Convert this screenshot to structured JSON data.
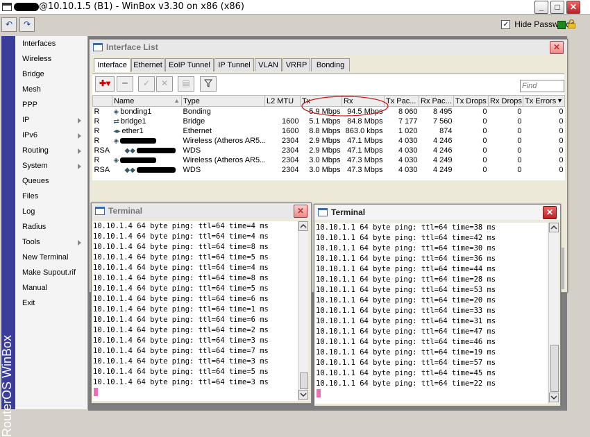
{
  "window": {
    "title_prefix": "",
    "title": "@10.10.1.5 (B1) - WinBox v3.30 on x86 (x86)",
    "min_glyph": "_",
    "max_glyph": "□",
    "close_glyph": "✕"
  },
  "toolbar": {
    "undo_glyph": "↶",
    "redo_glyph": "↷",
    "hide_passwords_label": "Hide Passwords",
    "hide_passwords_checked": "✓"
  },
  "sidebar": {
    "brand": "RouterOS WinBox",
    "items": [
      {
        "label": "Interfaces"
      },
      {
        "label": "Wireless"
      },
      {
        "label": "Bridge"
      },
      {
        "label": "Mesh"
      },
      {
        "label": "PPP"
      },
      {
        "label": "IP"
      },
      {
        "label": "IPv6"
      },
      {
        "label": "Routing"
      },
      {
        "label": "System"
      },
      {
        "label": "Queues"
      },
      {
        "label": "Files"
      },
      {
        "label": "Log"
      },
      {
        "label": "Radius"
      },
      {
        "label": "Tools"
      },
      {
        "label": "New Terminal"
      },
      {
        "label": "Make Supout.rif"
      },
      {
        "label": "Manual"
      },
      {
        "label": "Exit"
      }
    ]
  },
  "interface_list": {
    "title": "Interface List",
    "tabs": [
      "Interface",
      "Ethernet",
      "EoIP Tunnel",
      "IP Tunnel",
      "VLAN",
      "VRRP",
      "Bonding"
    ],
    "find_placeholder": "Find",
    "columns": [
      "",
      "Name",
      "Type",
      "L2 MTU",
      "Tx",
      "Rx",
      "Tx Pac...",
      "Rx Pac...",
      "Tx Drops",
      "Rx Drops",
      "Tx Errors"
    ],
    "rows": [
      {
        "flags": "R",
        "name": "bonding1",
        "type": "Bonding",
        "mtu": "",
        "tx": "5.9 Mbps",
        "rx": "94.5 Mbps",
        "txp": "8 060",
        "rxp": "8 495",
        "txd": "0",
        "rxd": "0",
        "txe": "0"
      },
      {
        "flags": "R",
        "name": "bridge1",
        "type": "Bridge",
        "mtu": "1600",
        "tx": "5.1 Mbps",
        "rx": "84.8 Mbps",
        "txp": "7 177",
        "rxp": "7 560",
        "txd": "0",
        "rxd": "0",
        "txe": "0"
      },
      {
        "flags": "R",
        "name": "ether1",
        "type": "Ethernet",
        "mtu": "1600",
        "tx": "8.8 Mbps",
        "rx": "863.0 kbps",
        "txp": "1 020",
        "rxp": "874",
        "txd": "0",
        "rxd": "0",
        "txe": "0"
      },
      {
        "flags": "R",
        "name": "",
        "type": "Wireless (Atheros AR5...",
        "mtu": "2304",
        "tx": "2.9 Mbps",
        "rx": "47.1 Mbps",
        "txp": "4 030",
        "rxp": "4 246",
        "txd": "0",
        "rxd": "0",
        "txe": "0"
      },
      {
        "flags": "RSA",
        "name": "",
        "type": "WDS",
        "mtu": "2304",
        "tx": "2.9 Mbps",
        "rx": "47.1 Mbps",
        "txp": "4 030",
        "rxp": "4 246",
        "txd": "0",
        "rxd": "0",
        "txe": "0"
      },
      {
        "flags": "R",
        "name": "",
        "type": "Wireless (Atheros AR5...",
        "mtu": "2304",
        "tx": "3.0 Mbps",
        "rx": "47.3 Mbps",
        "txp": "4 030",
        "rxp": "4 249",
        "txd": "0",
        "rxd": "0",
        "txe": "0"
      },
      {
        "flags": "RSA",
        "name": "",
        "type": "WDS",
        "mtu": "2304",
        "tx": "3.0 Mbps",
        "rx": "47.3 Mbps",
        "txp": "4 030",
        "rxp": "4 249",
        "txd": "0",
        "rxd": "0",
        "txe": "0"
      }
    ]
  },
  "terminal_left": {
    "title": "Terminal",
    "lines": [
      "10.10.1.4 64 byte ping: ttl=64 time=4 ms",
      "10.10.1.4 64 byte ping: ttl=64 time=4 ms",
      "10.10.1.4 64 byte ping: ttl=64 time=8 ms",
      "10.10.1.4 64 byte ping: ttl=64 time=5 ms",
      "10.10.1.4 64 byte ping: ttl=64 time=4 ms",
      "10.10.1.4 64 byte ping: ttl=64 time=8 ms",
      "10.10.1.4 64 byte ping: ttl=64 time=5 ms",
      "10.10.1.4 64 byte ping: ttl=64 time=6 ms",
      "10.10.1.4 64 byte ping: ttl=64 time=1 ms",
      "10.10.1.4 64 byte ping: ttl=64 time=6 ms",
      "10.10.1.4 64 byte ping: ttl=64 time=2 ms",
      "10.10.1.4 64 byte ping: ttl=64 time=3 ms",
      "10.10.1.4 64 byte ping: ttl=64 time=7 ms",
      "10.10.1.4 64 byte ping: ttl=64 time=3 ms",
      "10.10.1.4 64 byte ping: ttl=64 time=5 ms",
      "10.10.1.4 64 byte ping: ttl=64 time=3 ms"
    ]
  },
  "terminal_right": {
    "title": "Terminal",
    "lines": [
      "10.10.1.1 64 byte ping: ttl=64 time=38 ms",
      "10.10.1.1 64 byte ping: ttl=64 time=42 ms",
      "10.10.1.1 64 byte ping: ttl=64 time=30 ms",
      "10.10.1.1 64 byte ping: ttl=64 time=36 ms",
      "10.10.1.1 64 byte ping: ttl=64 time=44 ms",
      "10.10.1.1 64 byte ping: ttl=64 time=28 ms",
      "10.10.1.1 64 byte ping: ttl=64 time=53 ms",
      "10.10.1.1 64 byte ping: ttl=64 time=20 ms",
      "10.10.1.1 64 byte ping: ttl=64 time=33 ms",
      "10.10.1.1 64 byte ping: ttl=64 time=31 ms",
      "10.10.1.1 64 byte ping: ttl=64 time=47 ms",
      "10.10.1.1 64 byte ping: ttl=64 time=46 ms",
      "10.10.1.1 64 byte ping: ttl=64 time=19 ms",
      "10.10.1.1 64 byte ping: ttl=64 time=57 ms",
      "10.10.1.1 64 byte ping: ttl=64 time=45 ms",
      "10.10.1.1 64 byte ping: ttl=64 time=22 ms"
    ]
  },
  "colors": {
    "sidebar_strip": "#3a3d9a",
    "annotation_circle": "#d01010",
    "cursor": "#e870b8"
  }
}
